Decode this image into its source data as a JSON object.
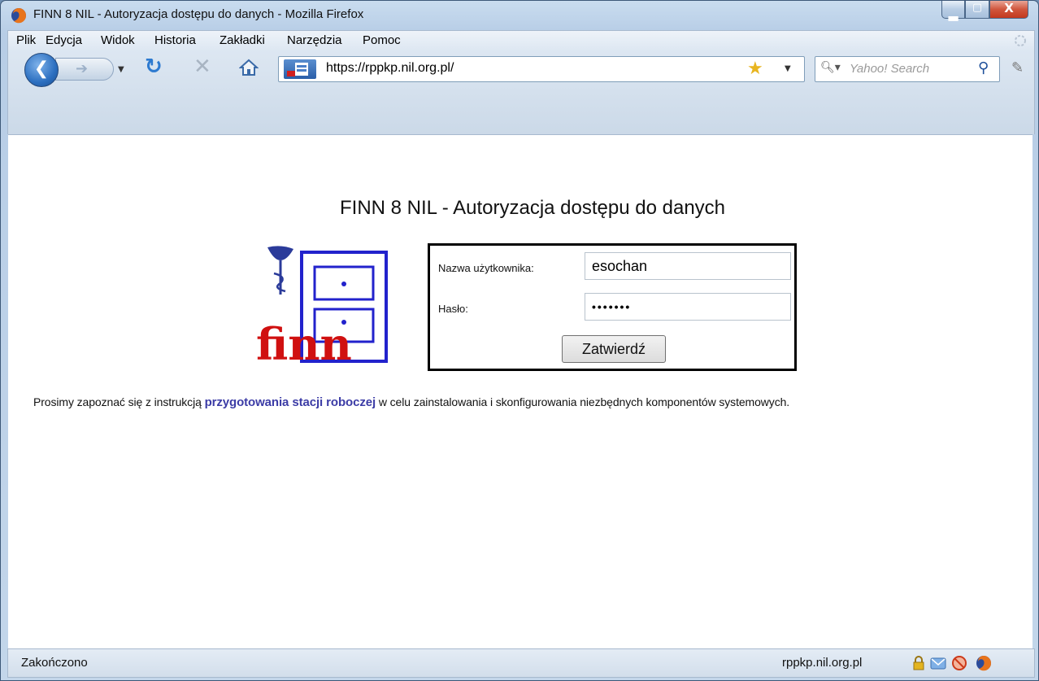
{
  "window": {
    "title": "FINN 8 NIL - Autoryzacja dostępu do danych - Mozilla Firefox"
  },
  "menu": [
    {
      "label": "Plik"
    },
    {
      "label": "Edycja"
    },
    {
      "label": "Widok"
    },
    {
      "label": "Historia"
    },
    {
      "label": "Zakładki"
    },
    {
      "label": "Narzędzia"
    },
    {
      "label": "Pomoc"
    }
  ],
  "navbar": {
    "url": "https://rppkp.nil.org.pl/",
    "search_placeholder": "Yahoo! Search"
  },
  "page": {
    "title": "FINN 8 NIL - Autoryzacja dostępu do danych",
    "logo_text": "finn",
    "form": {
      "username_label": "Nazwa użytkownika:",
      "username_value": "esochan",
      "password_label": "Hasło:",
      "password_value": "•••••••",
      "submit_label": "Zatwierdź"
    },
    "info_before": "Prosimy zapoznać się z instrukcją ",
    "info_link": "przygotowania stacji roboczej",
    "info_after": " w celu zainstalowania i skonfigurowania niezbędnych komponentów systemowych."
  },
  "statusbar": {
    "status": "Zakończono",
    "host": "rppkp.nil.org.pl"
  },
  "colors": {
    "link": "#3c3ca6",
    "logo_red": "#d01010",
    "logo_blue": "#2222cc"
  }
}
